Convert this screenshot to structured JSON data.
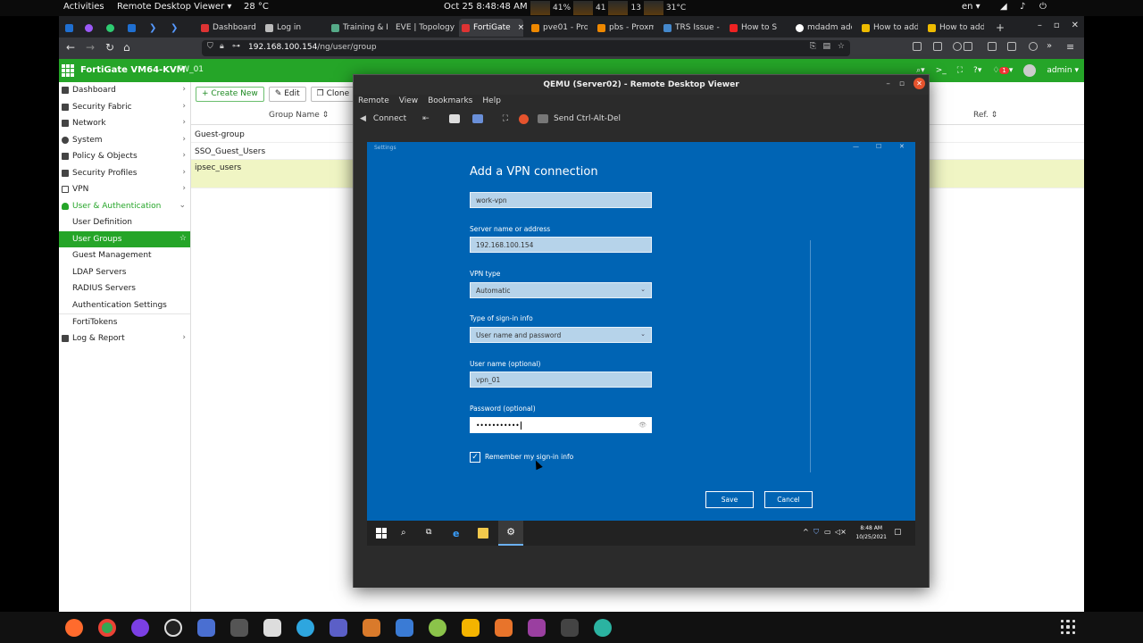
{
  "gnome": {
    "activities": "Activities",
    "app_menu": "Remote Desktop Viewer ▾",
    "weather": "28 °C",
    "clock": "Oct 25  8:48:48 AM",
    "perf": [
      "41%",
      "41",
      "13",
      "31°C"
    ],
    "lang": "en ▾"
  },
  "browser": {
    "tabs": [
      {
        "label": "Dashboard |",
        "color": "#d33"
      },
      {
        "label": "Log in",
        "color": "#bbb"
      },
      {
        "label": "Training & L",
        "color": "#5a8"
      },
      {
        "label": "EVE | Topology",
        "color": "#888"
      },
      {
        "label": "FortiGate",
        "color": "#d33"
      },
      {
        "label": "pve01 - Prox",
        "color": "#e80"
      },
      {
        "label": "pbs - Proxm",
        "color": "#e80"
      },
      {
        "label": "TRS Issue - T",
        "color": "#48c"
      },
      {
        "label": "How to S",
        "color": "#e22"
      },
      {
        "label": "mdadm add",
        "color": "#fff"
      },
      {
        "label": "How to add",
        "color": "#eb0"
      },
      {
        "label": "How to add",
        "color": "#eb0"
      }
    ],
    "url_host": "192.168.100.154",
    "url_path": "/ng/user/group"
  },
  "fortigate": {
    "product": "FortiGate VM64-KVM",
    "hostname": "FW_01",
    "notif_count": "1",
    "admin": "admin ▾",
    "nav": [
      {
        "label": "Dashboard",
        "chev": "›"
      },
      {
        "label": "Security Fabric",
        "chev": "›"
      },
      {
        "label": "Network",
        "chev": "›"
      },
      {
        "label": "System",
        "chev": "›"
      },
      {
        "label": "Policy & Objects",
        "chev": "›"
      },
      {
        "label": "Security Profiles",
        "chev": "›"
      },
      {
        "label": "VPN",
        "chev": "›"
      },
      {
        "label": "User & Authentication",
        "chev": "⌄"
      }
    ],
    "subnav": [
      "User Definition",
      "User Groups",
      "Guest Management",
      "LDAP Servers",
      "RADIUS Servers",
      "Authentication Settings",
      "FortiTokens"
    ],
    "nav_last": {
      "label": "Log & Report",
      "chev": "›"
    },
    "toolbar": {
      "create": "+ Create New",
      "edit": "✎ Edit",
      "clone": "❐ Clone"
    },
    "columns": {
      "group_name": "Group Name ⇕",
      "ref": "Ref. ⇕"
    },
    "rows": [
      "Guest-group",
      "SSO_Guest_Users",
      "ipsec_users"
    ]
  },
  "rdv": {
    "title": "QEMU (Server02) - Remote Desktop Viewer",
    "menu": [
      "Remote",
      "View",
      "Bookmarks",
      "Help"
    ],
    "connect": "Connect",
    "send_cad": "Send Ctrl-Alt-Del"
  },
  "vpn_dialog": {
    "window_title": "Settings",
    "heading": "Add a VPN connection",
    "connection_name_value": "work-vpn",
    "server_label": "Server name or address",
    "server_value": "192.168.100.154",
    "vpn_type_label": "VPN type",
    "vpn_type_value": "Automatic",
    "signin_label": "Type of sign-in info",
    "signin_value": "User name and password",
    "username_label": "User name (optional)",
    "username_value": "vpn_01",
    "password_label": "Password (optional)",
    "password_value": "•••••••••••",
    "remember_label": "Remember my sign-in info",
    "save": "Save",
    "cancel": "Cancel"
  },
  "vm_taskbar": {
    "time": "8:48 AM",
    "date": "10/25/2021"
  },
  "colors": {
    "fortigate_green": "#25a528",
    "win_blue": "#0064b4"
  }
}
